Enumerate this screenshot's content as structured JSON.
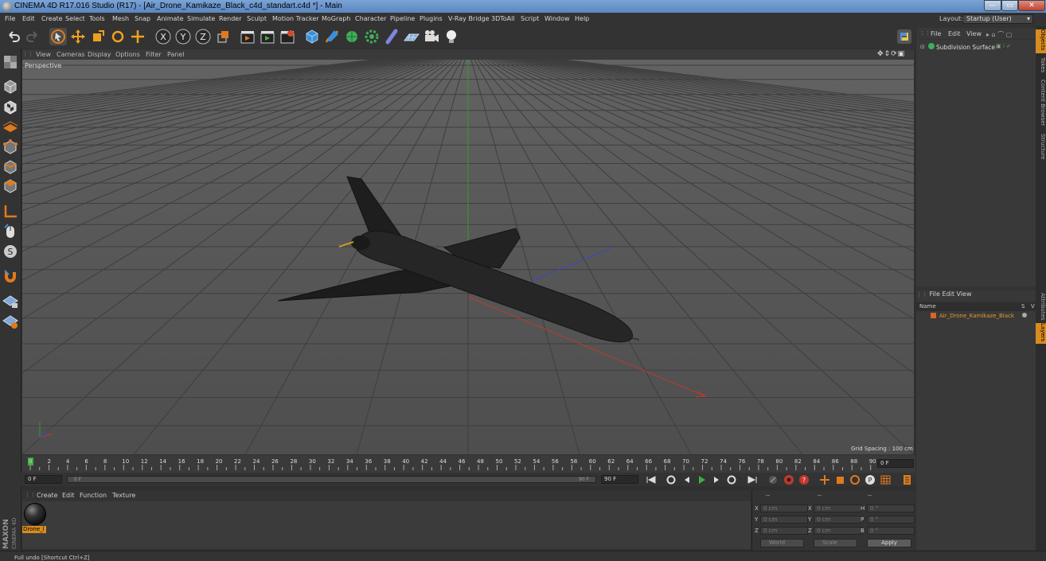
{
  "window": {
    "title": "CINEMA 4D R17.016 Studio (R17) - [Air_Drone_Kamikaze_Black_c4d_standart.c4d *] - Main"
  },
  "menu": [
    "File",
    "Edit",
    "Create",
    "Select",
    "Tools",
    "Mesh",
    "Snap",
    "Animate",
    "Simulate",
    "Render",
    "Sculpt",
    "Motion Tracker",
    "MoGraph",
    "Character",
    "Pipeline",
    "Plugins",
    "V-Ray Bridge",
    "3DToAll",
    "Script",
    "Window",
    "Help"
  ],
  "layout": {
    "label": "Layout:",
    "value": "Startup (User)"
  },
  "viewport": {
    "menu": [
      "View",
      "Cameras",
      "Display",
      "Options",
      "Filter",
      "Panel"
    ],
    "label": "Perspective",
    "grid_spacing": "Grid Spacing : 100 cm"
  },
  "timeline": {
    "ticks": [
      "0",
      "2",
      "4",
      "6",
      "8",
      "10",
      "12",
      "14",
      "16",
      "18",
      "20",
      "22",
      "24",
      "26",
      "28",
      "30",
      "32",
      "34",
      "36",
      "38",
      "40",
      "42",
      "44",
      "46",
      "48",
      "50",
      "52",
      "54",
      "56",
      "58",
      "60",
      "62",
      "64",
      "66",
      "68",
      "70",
      "72",
      "74",
      "76",
      "78",
      "80",
      "82",
      "84",
      "86",
      "88",
      "90"
    ],
    "current_frame": "0 F",
    "start_frame": "0 F",
    "slider_start": "0 F",
    "slider_end": "90 F",
    "end_frame": "90 F"
  },
  "material_manager": {
    "menu": [
      "Create",
      "Edit",
      "Function",
      "Texture"
    ],
    "materials": [
      {
        "name": "Drone_l"
      }
    ]
  },
  "coordinates": {
    "header": [
      "--",
      "--",
      "--"
    ],
    "rows": [
      {
        "axis": "X",
        "pos": "0 cm",
        "size_axis": "X",
        "size": "0 cm",
        "rot_axis": "H",
        "rot": "0 °"
      },
      {
        "axis": "Y",
        "pos": "0 cm",
        "size_axis": "Y",
        "size": "0 cm",
        "rot_axis": "P",
        "rot": "0 °"
      },
      {
        "axis": "Z",
        "pos": "0 cm",
        "size_axis": "Z",
        "size": "0 cm",
        "rot_axis": "B",
        "rot": "0 °"
      }
    ],
    "mode": "World",
    "scale_mode": "Scale",
    "apply_label": "Apply"
  },
  "object_manager": {
    "menu": [
      "File",
      "Edit",
      "View"
    ],
    "objects": [
      {
        "name": "Subdivision Surface"
      }
    ]
  },
  "layer_manager": {
    "menu": [
      "File",
      "Edit",
      "View"
    ],
    "columns": [
      "Name",
      "S",
      "V"
    ],
    "layers": [
      {
        "name": "Air_Drone_Kamikaze_Black",
        "color": "#d8661e"
      }
    ]
  },
  "right_tabs": [
    "Objects",
    "Takes",
    "Content Browser",
    "Structure"
  ],
  "right_tabs_lower": [
    "Attributes",
    "Layers"
  ],
  "status": "Full undo [Shortcut Ctrl+Z]",
  "brand": {
    "vendor": "MAXON",
    "product": "CINEMA 4D"
  },
  "colors": {
    "accent": "#d88c1e",
    "viewport_bg": "#5a5a5a",
    "x_axis": "#c0392b",
    "y_axis": "#2e9e2e",
    "z_axis": "#3b46c8"
  }
}
